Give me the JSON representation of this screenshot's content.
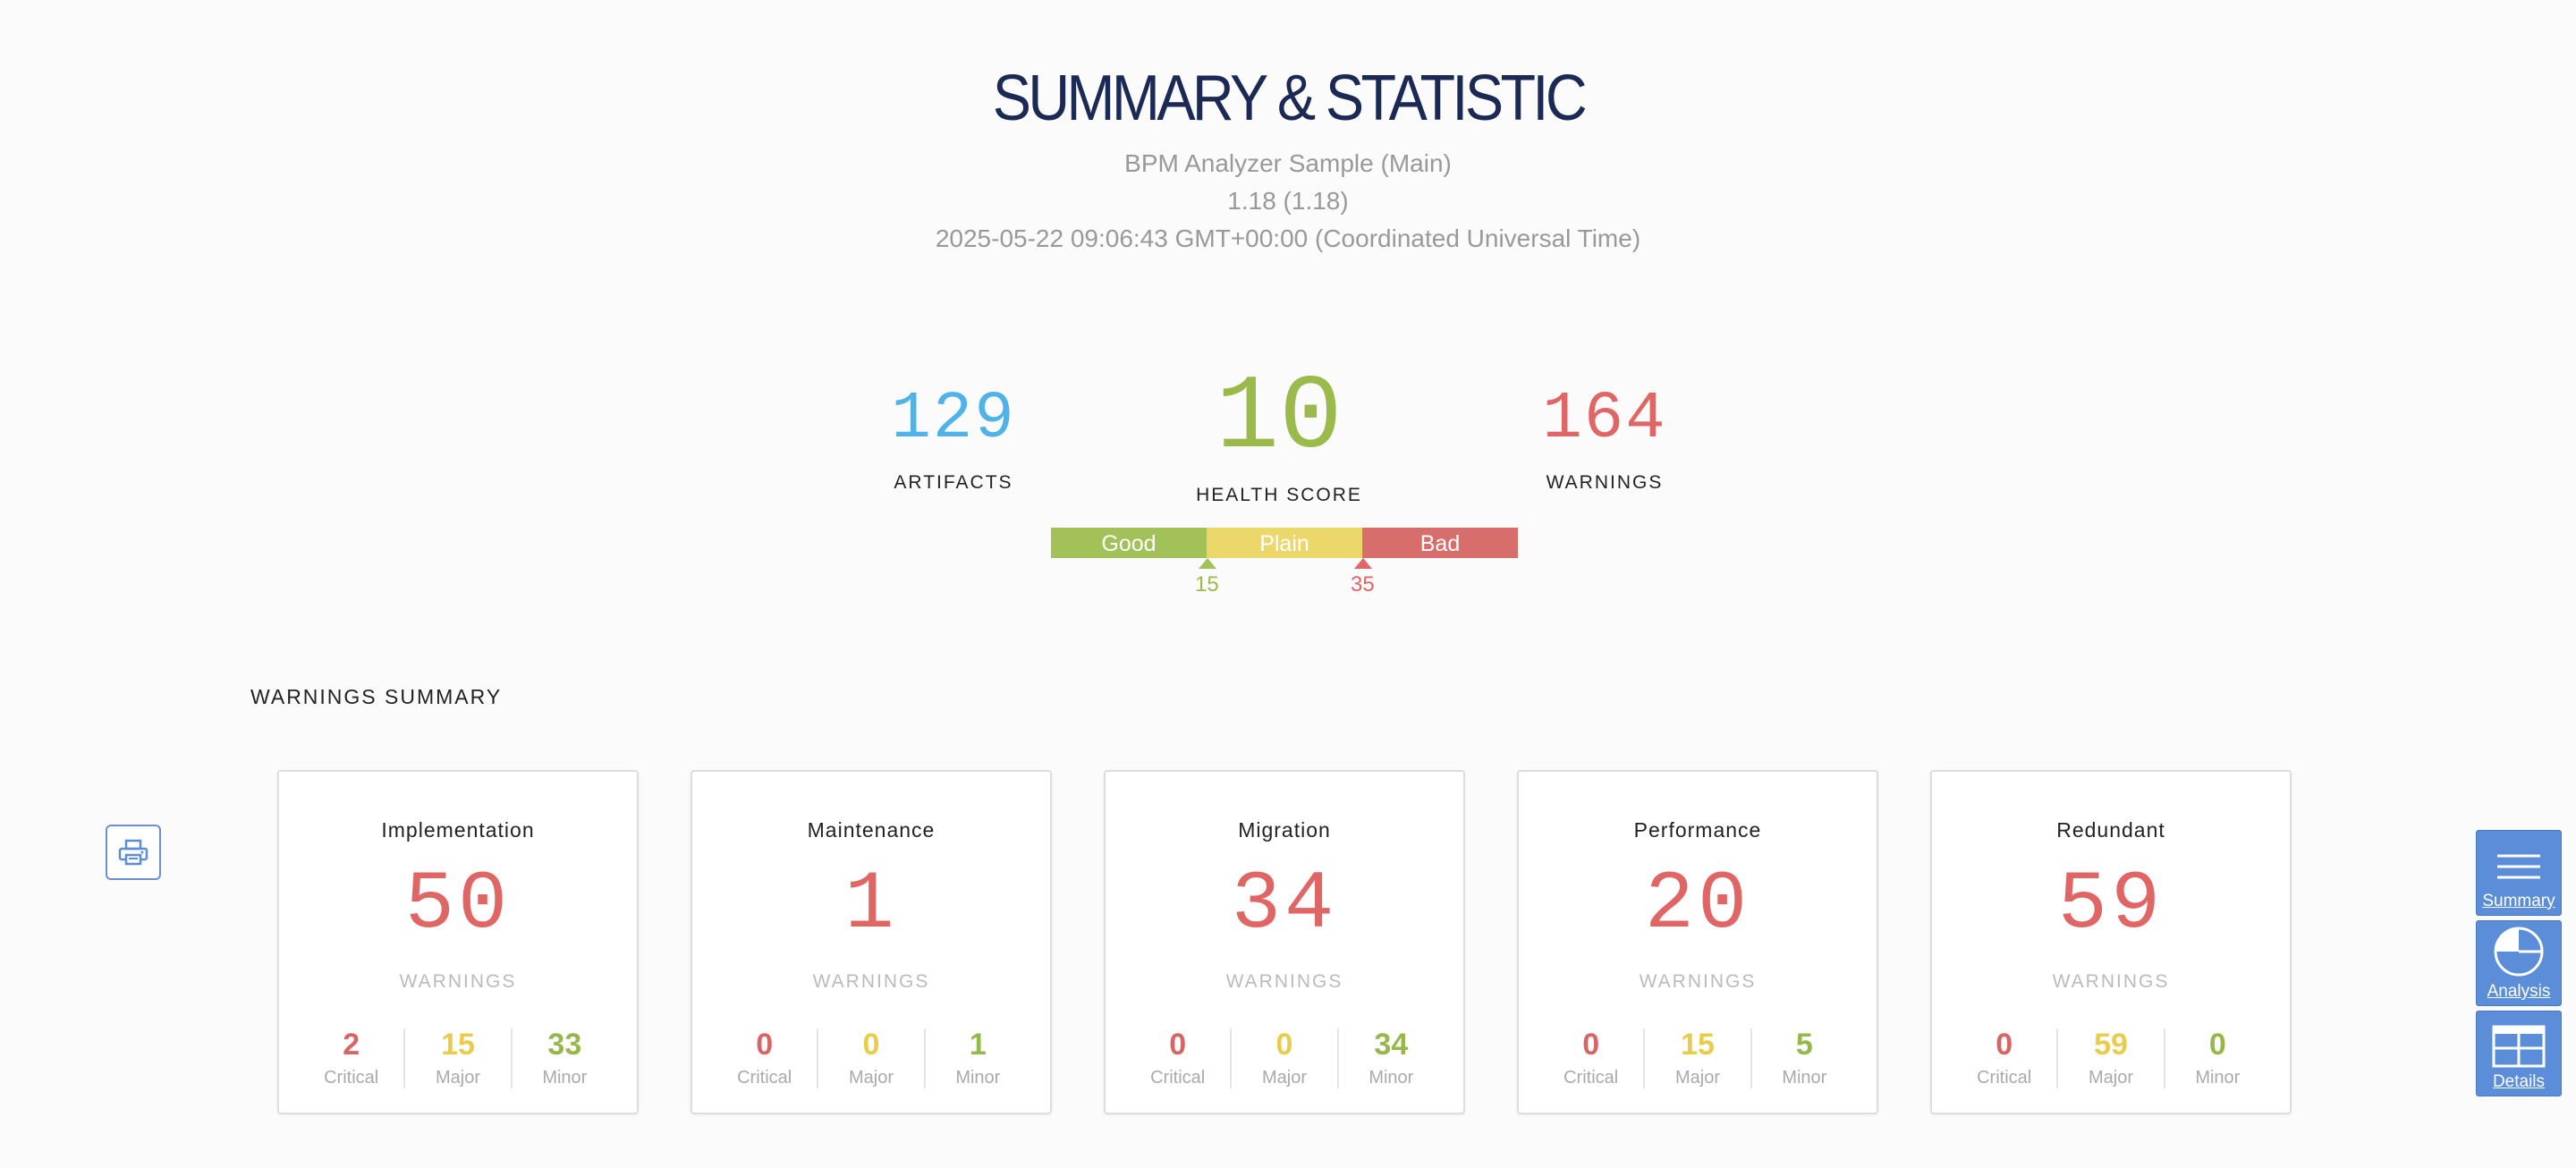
{
  "header": {
    "title": "SUMMARY & STATISTIC",
    "project": "BPM Analyzer Sample (Main)",
    "version": "1.18 (1.18)",
    "timestamp": "2025-05-22 09:06:43 GMT+00:00 (Coordinated Universal Time)"
  },
  "stats": {
    "artifacts": {
      "value": "129",
      "label": "ARTIFACTS"
    },
    "health": {
      "value": "10",
      "label": "HEALTH SCORE"
    },
    "warnings": {
      "value": "164",
      "label": "WARNINGS"
    }
  },
  "scale": {
    "good": "Good",
    "plain": "Plain",
    "bad": "Bad",
    "threshold_low": "15",
    "threshold_high": "35",
    "colors": {
      "good": "#a2c159",
      "plain": "#ecd76a",
      "bad": "#d76e6b"
    }
  },
  "warnings_summary": {
    "title": "WARNINGS SUMMARY",
    "warnings_label": "WARNINGS",
    "sev_labels": {
      "critical": "Critical",
      "major": "Major",
      "minor": "Minor"
    },
    "cards": [
      {
        "name": "Implementation",
        "total": "50",
        "critical": "2",
        "major": "15",
        "minor": "33"
      },
      {
        "name": "Maintenance",
        "total": "1",
        "critical": "0",
        "major": "0",
        "minor": "1"
      },
      {
        "name": "Migration",
        "total": "34",
        "critical": "0",
        "major": "0",
        "minor": "34"
      },
      {
        "name": "Performance",
        "total": "20",
        "critical": "0",
        "major": "15",
        "minor": "5"
      },
      {
        "name": "Redundant",
        "total": "59",
        "critical": "0",
        "major": "59",
        "minor": "0"
      }
    ]
  },
  "print": {
    "icon": "printer-icon"
  },
  "side_nav": [
    {
      "label": "Summary",
      "icon": "list-icon"
    },
    {
      "label": "Analysis",
      "icon": "pie-chart-icon"
    },
    {
      "label": "Details",
      "icon": "table-icon"
    }
  ],
  "colors": {
    "accent": "#5b8dd9",
    "critical": "#d96464",
    "major": "#e8cc4a",
    "minor": "#96b84a"
  }
}
